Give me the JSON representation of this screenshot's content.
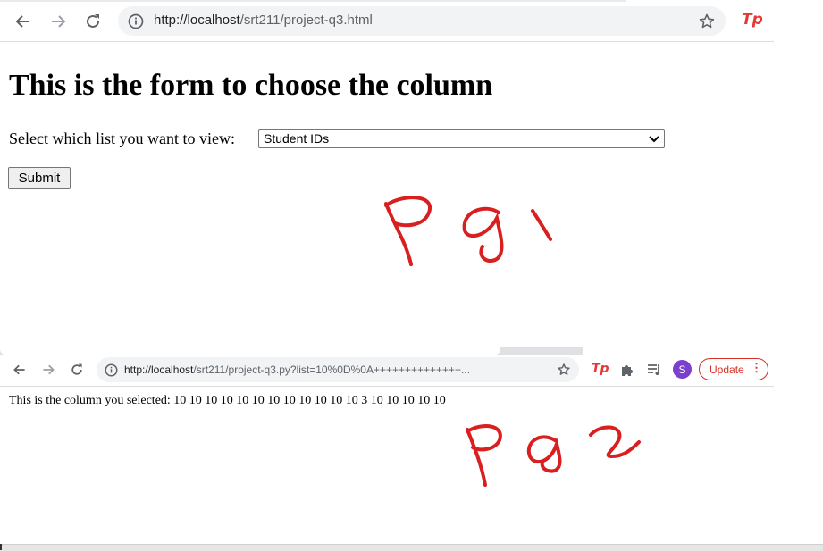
{
  "window1": {
    "url_host": "http://localhost",
    "url_path": "/srt211/project-q3.html",
    "heading": "This is the form to choose the column",
    "select_label": "Select which list you want to view:",
    "select_value": "Student IDs",
    "submit_label": "Submit",
    "extension_label": "Tp"
  },
  "window2": {
    "url_host": "http://localhost",
    "url_path": "/srt211/project-q3.py?list=10%0D%0A++++++++++++++...",
    "extension_label": "Tp",
    "avatar_letter": "S",
    "update_label": "Update",
    "update_menu_glyph": "⋮",
    "result_text": "This is the column you selected: 10 10 10 10 10 10 10 10 10 10 10 10 3 10 10 10 10 10"
  },
  "annotations": {
    "pg1": "Pg 1",
    "pg2": "Pg 2",
    "ink_color": "#d91f1f"
  },
  "icons": {
    "back": "back-arrow-icon",
    "forward": "forward-arrow-icon",
    "reload": "reload-icon",
    "info": "info-icon",
    "star": "star-icon",
    "puzzle": "puzzle-icon",
    "reading_list": "reading-list-icon"
  }
}
